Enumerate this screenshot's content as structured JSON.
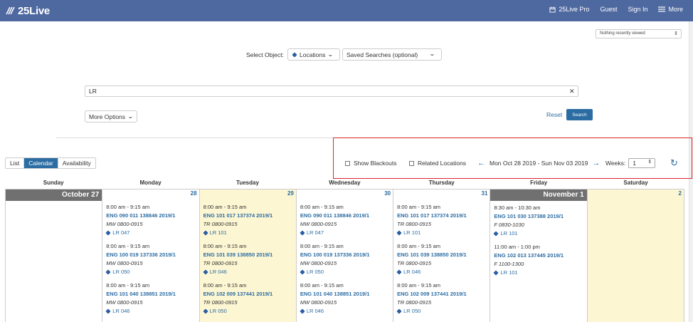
{
  "header": {
    "logo_text": "25Live",
    "nav": {
      "pro": "25Live Pro",
      "guest": "Guest",
      "signin": "Sign In",
      "more": "More"
    }
  },
  "recent": {
    "label": "Nothing recently viewed"
  },
  "select_object": {
    "label": "Select Object:",
    "object_value": "Locations",
    "saved_searches": "Saved Searches (optional)"
  },
  "search": {
    "value": "LR",
    "more_options": "More Options",
    "reset": "Reset",
    "search_button": "Search"
  },
  "view_toggle": {
    "list": "List",
    "calendar": "Calendar",
    "availability": "Availability"
  },
  "controls": {
    "show_blackouts": "Show Blackouts",
    "related_locations": "Related Locations",
    "date_range": "Mon Oct 28 2019 - Sun Nov 03 2019",
    "weeks_label": "Weeks:",
    "weeks_value": "1"
  },
  "calendar": {
    "day_names": [
      "Sunday",
      "Monday",
      "Tuesday",
      "Wednesday",
      "Thursday",
      "Friday",
      "Saturday"
    ],
    "days": [
      {
        "label": "October 27",
        "events": []
      },
      {
        "label": "28",
        "events": [
          {
            "time": "8:00 am - 9:15 am",
            "title": "ENG 090 011 138846 2019/1",
            "sched": "MW 0800-0915",
            "loc": "LR 047"
          },
          {
            "time": "8:00 am - 9:15 am",
            "title": "ENG 100 019 137336 2019/1",
            "sched": "MW 0800-0915",
            "loc": "LR 050"
          },
          {
            "time": "8:00 am - 9:15 am",
            "title": "ENG 101 040 138851 2019/1",
            "sched": "MW 0800-0915",
            "loc": "LR 046"
          }
        ]
      },
      {
        "label": "29",
        "events": [
          {
            "time": "8:00 am - 9:15 am",
            "title": "ENG 101 017 137374 2019/1",
            "sched": "TR 0800-0915",
            "loc": "LR 101"
          },
          {
            "time": "8:00 am - 9:15 am",
            "title": "ENG 101 039 138850 2019/1",
            "sched": "TR 0800-0915",
            "loc": "LR 046"
          },
          {
            "time": "8:00 am - 9:15 am",
            "title": "ENG 102 009 137441 2019/1",
            "sched": "TR 0800-0915",
            "loc": "LR 050"
          }
        ]
      },
      {
        "label": "30",
        "events": [
          {
            "time": "8:00 am - 9:15 am",
            "title": "ENG 090 011 138846 2019/1",
            "sched": "MW 0800-0915",
            "loc": "LR 047"
          },
          {
            "time": "8:00 am - 9:15 am",
            "title": "ENG 100 019 137336 2019/1",
            "sched": "MW 0800-0915",
            "loc": "LR 050"
          },
          {
            "time": "8:00 am - 9:15 am",
            "title": "ENG 101 040 138851 2019/1",
            "sched": "MW 0800-0915",
            "loc": "LR 046"
          }
        ]
      },
      {
        "label": "31",
        "events": [
          {
            "time": "8:00 am - 9:15 am",
            "title": "ENG 101 017 137374 2019/1",
            "sched": "TR 0800-0915",
            "loc": "LR 101"
          },
          {
            "time": "8:00 am - 9:15 am",
            "title": "ENG 101 039 138850 2019/1",
            "sched": "TR 0800-0915",
            "loc": "LR 046"
          },
          {
            "time": "8:00 am - 9:15 am",
            "title": "ENG 102 009 137441 2019/1",
            "sched": "TR 0800-0915",
            "loc": "LR 050"
          }
        ]
      },
      {
        "label": "November 1",
        "events": [
          {
            "time": "8:30 am - 10:30 am",
            "title": "ENG 101 030 137388 2019/1",
            "sched": "F 0830-1030",
            "loc": "LR 101"
          },
          {
            "time": "11:00 am - 1:00 pm",
            "title": "ENG 102 013 137445 2019/1",
            "sched": "F 1100-1300",
            "loc": "LR 101"
          }
        ]
      },
      {
        "label": "2",
        "events": []
      }
    ]
  }
}
